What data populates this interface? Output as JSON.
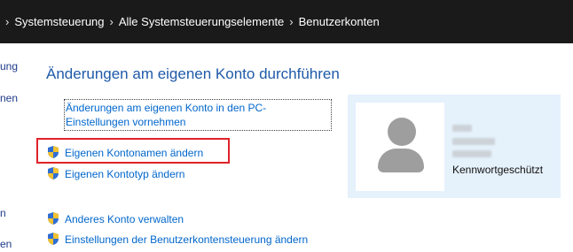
{
  "breadcrumb": {
    "items": [
      {
        "label": "Systemsteuerung"
      },
      {
        "label": "Alle Systemsteuerungselemente"
      },
      {
        "label": "Benutzerkonten"
      }
    ]
  },
  "sidebar": {
    "fragments": [
      "ung",
      "nen",
      "n",
      "en"
    ]
  },
  "main": {
    "heading": "Änderungen am eigenen Konto durchführen",
    "links": {
      "pc_settings": "Änderungen am eigenen Konto in den PC-Einstellungen vornehmen",
      "rename_account": "Eigenen Kontonamen ändern",
      "change_account_type": "Eigenen Kontotyp ändern",
      "manage_other_account": "Anderes Konto verwalten",
      "uac_settings": "Einstellungen der Benutzerkontensteuerung ändern"
    }
  },
  "account": {
    "status": "Kennwortgeschützt"
  },
  "colors": {
    "titlebar": "#1a1a1a",
    "link": "#0066cc",
    "heading": "#1e5aa8",
    "highlight": "#e0222a",
    "panel": "#e5f1fb"
  },
  "icons": {
    "breadcrumb_separator": "chevron-right-icon",
    "admin_link": "uac-shield-icon",
    "avatar": "user-avatar-icon"
  }
}
